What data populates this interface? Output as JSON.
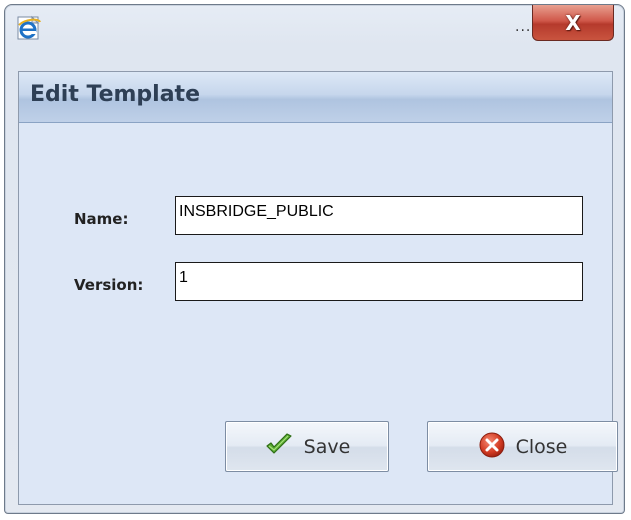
{
  "window": {
    "title": "...",
    "close_label": "X"
  },
  "dialog": {
    "header_title": "Edit Template"
  },
  "form": {
    "name_label": "Name:",
    "name_value": "INSBRIDGE_PUBLIC",
    "version_label": "Version:",
    "version_value": "1"
  },
  "buttons": {
    "save_label": "Save",
    "close_label": "Close"
  },
  "icons": {
    "app": "ie-logo-icon",
    "save": "checkmark-icon",
    "close": "red-x-circle-icon"
  },
  "colors": {
    "close_button": "#c9543f",
    "save_check": "#4a9a2a",
    "close_circle": "#d84a32"
  }
}
